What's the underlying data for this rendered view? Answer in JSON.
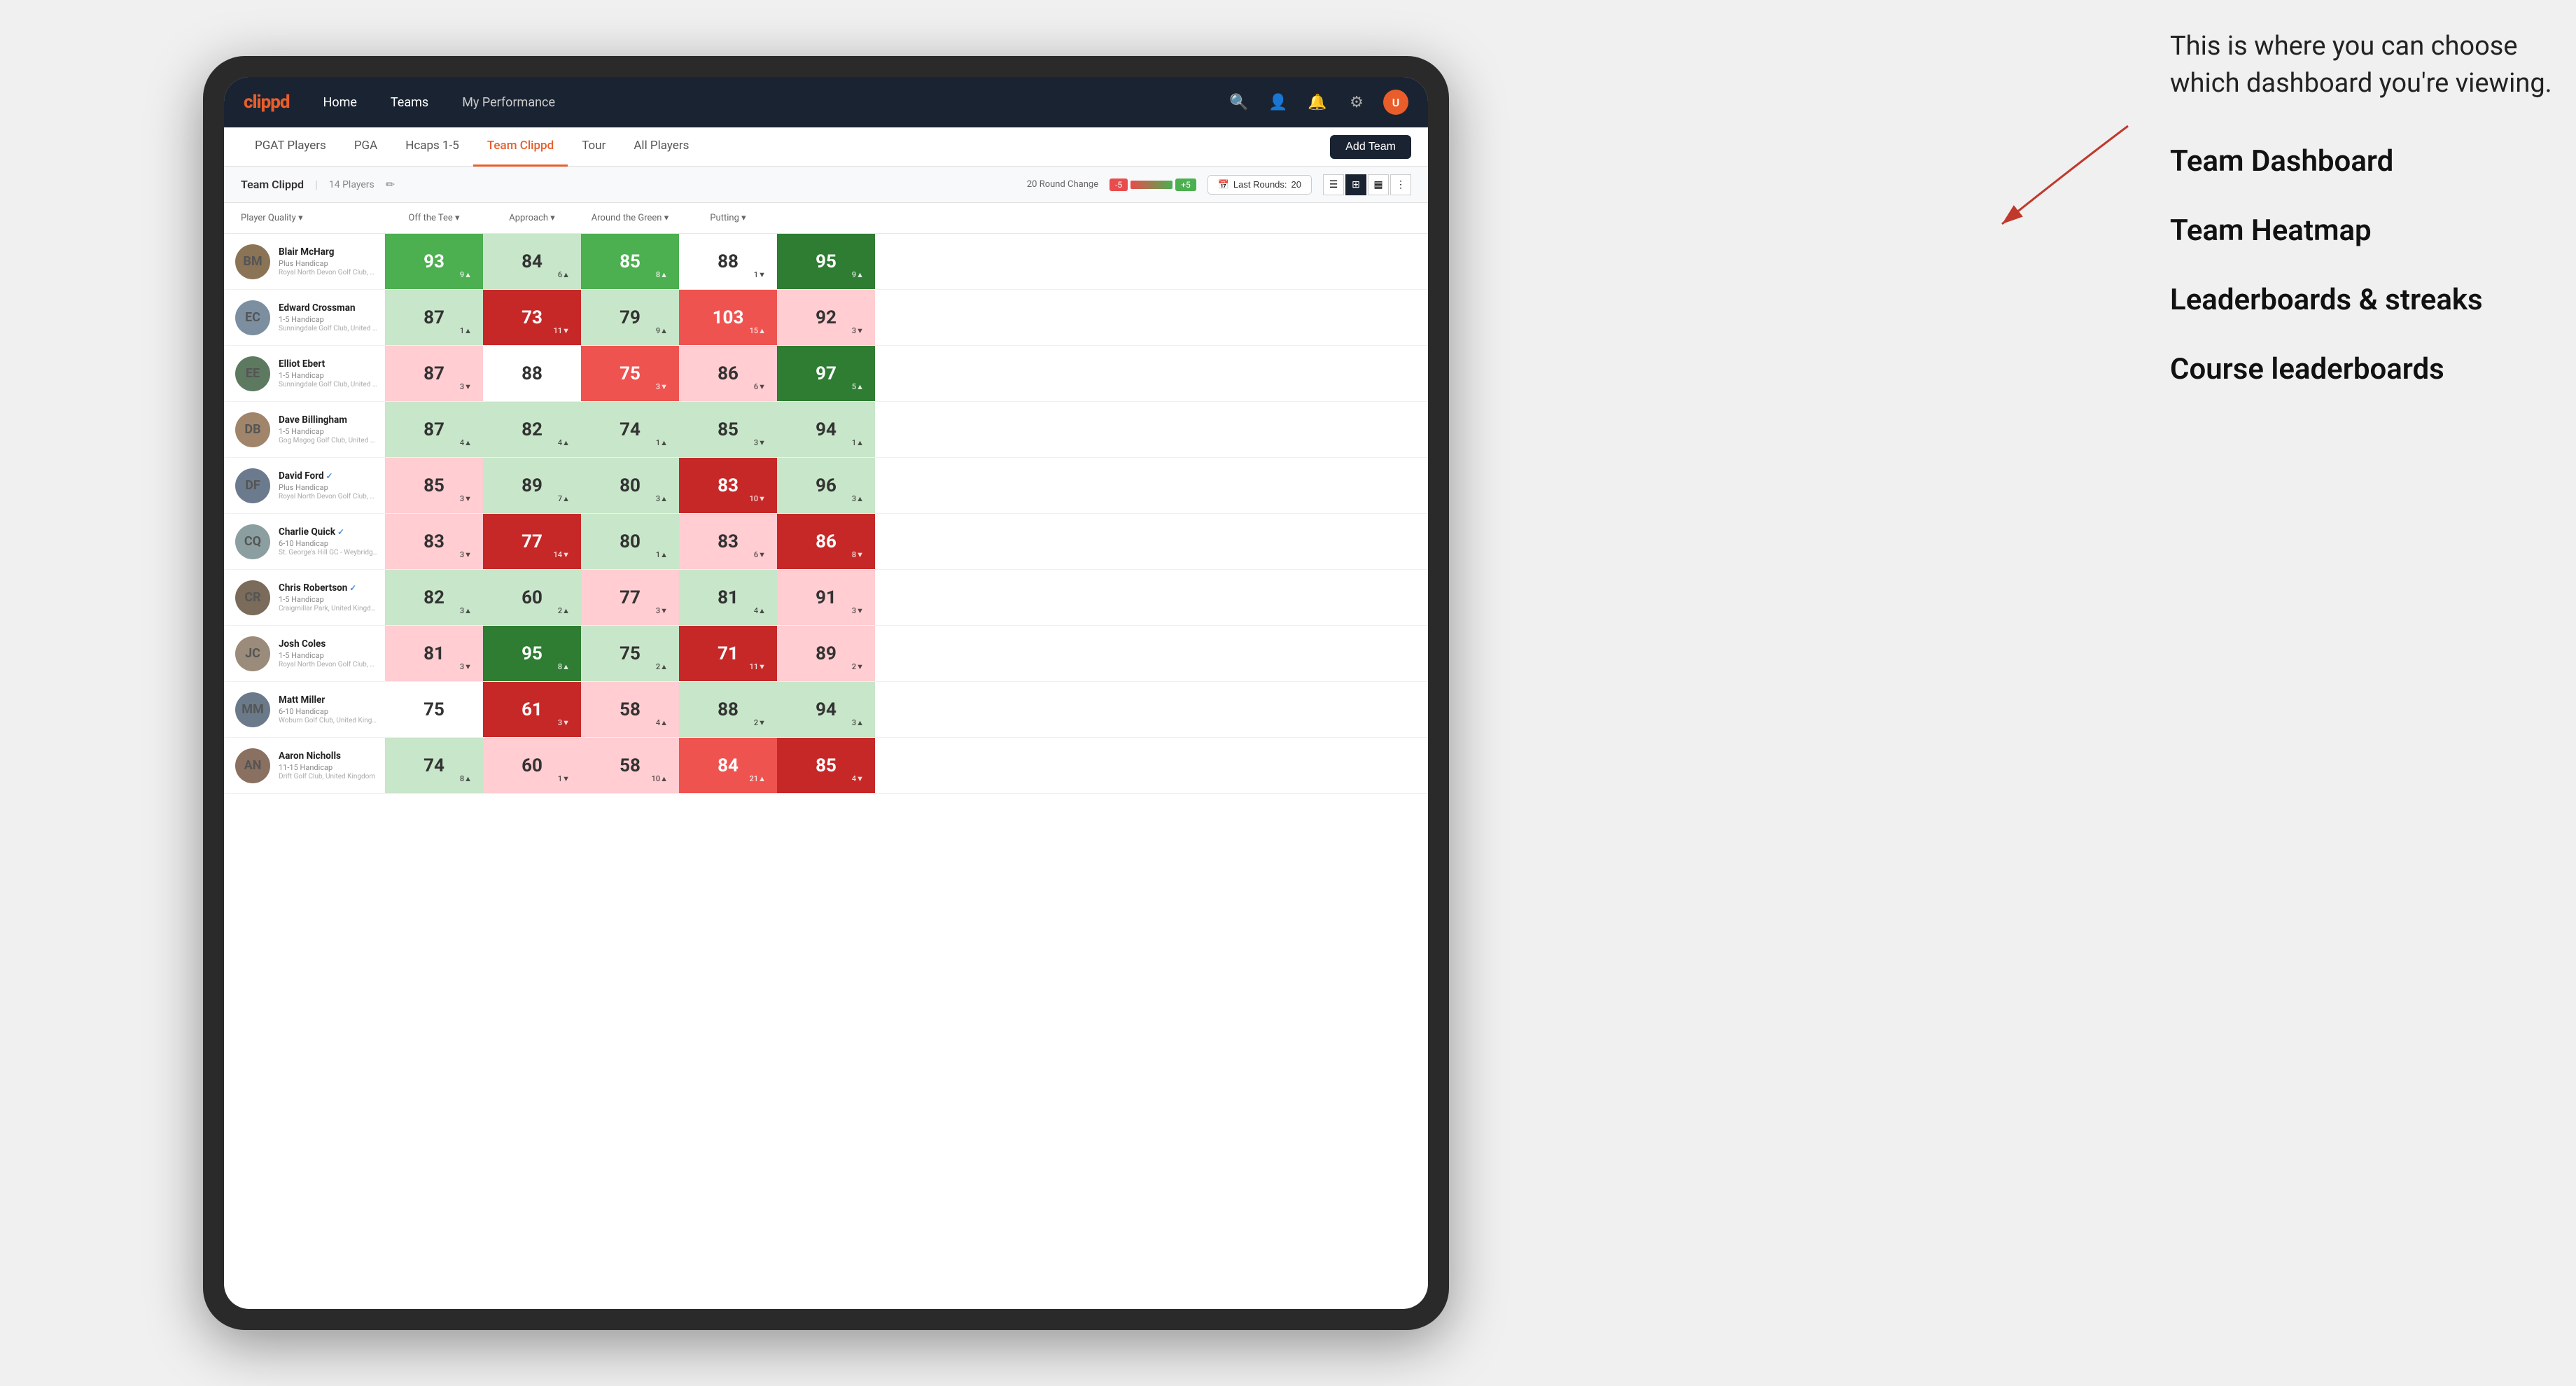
{
  "annotation": {
    "tooltip_text": "This is where you can choose which dashboard you're viewing.",
    "items": [
      "Team Dashboard",
      "Team Heatmap",
      "Leaderboards & streaks",
      "Course leaderboards"
    ]
  },
  "nav": {
    "logo": "clippd",
    "links": [
      "Home",
      "Teams",
      "My Performance"
    ],
    "active_link": "Teams"
  },
  "sub_nav": {
    "items": [
      "PGAT Players",
      "PGA",
      "Hcaps 1-5",
      "Team Clippd",
      "Tour",
      "All Players"
    ],
    "active": "Team Clippd",
    "add_team_label": "Add Team"
  },
  "team_header": {
    "name": "Team Clippd",
    "separator": "|",
    "player_count": "14 Players",
    "round_change_label": "20 Round Change",
    "badge_neg": "-5",
    "badge_pos": "+5",
    "last_rounds_label": "Last Rounds:",
    "last_rounds_value": "20"
  },
  "table": {
    "columns": [
      "Player Quality ▾",
      "Off the Tee ▾",
      "Approach ▾",
      "Around the Green ▾",
      "Putting ▾"
    ],
    "players": [
      {
        "name": "Blair McHarg",
        "handicap": "Plus Handicap",
        "club": "Royal North Devon Golf Club, United Kingdom",
        "avatar_color": "#8B7355",
        "avatar_initials": "BM",
        "scores": [
          {
            "value": 93,
            "change": "9▲",
            "direction": "up",
            "color": "green-med"
          },
          {
            "value": 84,
            "change": "6▲",
            "direction": "up",
            "color": "green-light"
          },
          {
            "value": 85,
            "change": "8▲",
            "direction": "up",
            "color": "green-med"
          },
          {
            "value": 88,
            "change": "1▼",
            "direction": "down",
            "color": "neutral"
          },
          {
            "value": 95,
            "change": "9▲",
            "direction": "up",
            "color": "green-dark"
          }
        ]
      },
      {
        "name": "Edward Crossman",
        "handicap": "1-5 Handicap",
        "club": "Sunningdale Golf Club, United Kingdom",
        "avatar_color": "#7B8FA1",
        "avatar_initials": "EC",
        "scores": [
          {
            "value": 87,
            "change": "1▲",
            "direction": "up",
            "color": "green-light"
          },
          {
            "value": 73,
            "change": "11▼",
            "direction": "down",
            "color": "red-dark"
          },
          {
            "value": 79,
            "change": "9▲",
            "direction": "up",
            "color": "green-light"
          },
          {
            "value": 103,
            "change": "15▲",
            "direction": "up",
            "color": "red-med"
          },
          {
            "value": 92,
            "change": "3▼",
            "direction": "down",
            "color": "red-light"
          }
        ]
      },
      {
        "name": "Elliot Ebert",
        "handicap": "1-5 Handicap",
        "club": "Sunningdale Golf Club, United Kingdom",
        "avatar_color": "#5D7A61",
        "avatar_initials": "EE",
        "scores": [
          {
            "value": 87,
            "change": "3▼",
            "direction": "down",
            "color": "red-light"
          },
          {
            "value": 88,
            "change": "",
            "direction": "none",
            "color": "neutral"
          },
          {
            "value": 75,
            "change": "3▼",
            "direction": "down",
            "color": "red-med"
          },
          {
            "value": 86,
            "change": "6▼",
            "direction": "down",
            "color": "red-light"
          },
          {
            "value": 97,
            "change": "5▲",
            "direction": "up",
            "color": "green-dark"
          }
        ]
      },
      {
        "name": "Dave Billingham",
        "handicap": "1-5 Handicap",
        "club": "Gog Magog Golf Club, United Kingdom",
        "avatar_color": "#A0856B",
        "avatar_initials": "DB",
        "scores": [
          {
            "value": 87,
            "change": "4▲",
            "direction": "up",
            "color": "green-light"
          },
          {
            "value": 82,
            "change": "4▲",
            "direction": "up",
            "color": "green-light"
          },
          {
            "value": 74,
            "change": "1▲",
            "direction": "up",
            "color": "green-light"
          },
          {
            "value": 85,
            "change": "3▼",
            "direction": "down",
            "color": "green-light"
          },
          {
            "value": 94,
            "change": "1▲",
            "direction": "up",
            "color": "green-light"
          }
        ]
      },
      {
        "name": "David Ford",
        "handicap": "Plus Handicap",
        "club": "Royal North Devon Golf Club, United Kingdom",
        "avatar_color": "#6B7B8D",
        "avatar_initials": "DF",
        "verified": true,
        "scores": [
          {
            "value": 85,
            "change": "3▼",
            "direction": "down",
            "color": "red-light"
          },
          {
            "value": 89,
            "change": "7▲",
            "direction": "up",
            "color": "green-light"
          },
          {
            "value": 80,
            "change": "3▲",
            "direction": "up",
            "color": "green-light"
          },
          {
            "value": 83,
            "change": "10▼",
            "direction": "down",
            "color": "red-dark"
          },
          {
            "value": 96,
            "change": "3▲",
            "direction": "up",
            "color": "green-light"
          }
        ]
      },
      {
        "name": "Charlie Quick",
        "handicap": "6-10 Handicap",
        "club": "St. George's Hill GC - Weybridge · Surrey, Uni...",
        "avatar_color": "#8B9EA0",
        "avatar_initials": "CQ",
        "verified": true,
        "scores": [
          {
            "value": 83,
            "change": "3▼",
            "direction": "down",
            "color": "red-light"
          },
          {
            "value": 77,
            "change": "14▼",
            "direction": "down",
            "color": "red-dark"
          },
          {
            "value": 80,
            "change": "1▲",
            "direction": "up",
            "color": "green-light"
          },
          {
            "value": 83,
            "change": "6▼",
            "direction": "down",
            "color": "red-light"
          },
          {
            "value": 86,
            "change": "8▼",
            "direction": "down",
            "color": "red-dark"
          }
        ]
      },
      {
        "name": "Chris Robertson",
        "handicap": "1-5 Handicap",
        "club": "Craigmillar Park, United Kingdom",
        "avatar_color": "#7A6B5A",
        "avatar_initials": "CR",
        "verified": true,
        "scores": [
          {
            "value": 82,
            "change": "3▲",
            "direction": "up",
            "color": "green-light"
          },
          {
            "value": 60,
            "change": "2▲",
            "direction": "up",
            "color": "green-light"
          },
          {
            "value": 77,
            "change": "3▼",
            "direction": "down",
            "color": "red-light"
          },
          {
            "value": 81,
            "change": "4▲",
            "direction": "up",
            "color": "green-light"
          },
          {
            "value": 91,
            "change": "3▼",
            "direction": "down",
            "color": "red-light"
          }
        ]
      },
      {
        "name": "Josh Coles",
        "handicap": "1-5 Handicap",
        "club": "Royal North Devon Golf Club, United Kingdom",
        "avatar_color": "#9B8B7A",
        "avatar_initials": "JC",
        "scores": [
          {
            "value": 81,
            "change": "3▼",
            "direction": "down",
            "color": "red-light"
          },
          {
            "value": 95,
            "change": "8▲",
            "direction": "up",
            "color": "green-dark"
          },
          {
            "value": 75,
            "change": "2▲",
            "direction": "up",
            "color": "green-light"
          },
          {
            "value": 71,
            "change": "11▼",
            "direction": "down",
            "color": "red-dark"
          },
          {
            "value": 89,
            "change": "2▼",
            "direction": "down",
            "color": "red-light"
          }
        ]
      },
      {
        "name": "Matt Miller",
        "handicap": "6-10 Handicap",
        "club": "Woburn Golf Club, United Kingdom",
        "avatar_color": "#6A7A8A",
        "avatar_initials": "MM",
        "scores": [
          {
            "value": 75,
            "change": "",
            "direction": "none",
            "color": "neutral"
          },
          {
            "value": 61,
            "change": "3▼",
            "direction": "down",
            "color": "red-dark"
          },
          {
            "value": 58,
            "change": "4▲",
            "direction": "up",
            "color": "red-light"
          },
          {
            "value": 88,
            "change": "2▼",
            "direction": "down",
            "color": "green-light"
          },
          {
            "value": 94,
            "change": "3▲",
            "direction": "up",
            "color": "green-light"
          }
        ]
      },
      {
        "name": "Aaron Nicholls",
        "handicap": "11-15 Handicap",
        "club": "Drift Golf Club, United Kingdom",
        "avatar_color": "#8A7060",
        "avatar_initials": "AN",
        "scores": [
          {
            "value": 74,
            "change": "8▲",
            "direction": "up",
            "color": "green-light"
          },
          {
            "value": 60,
            "change": "1▼",
            "direction": "down",
            "color": "red-light"
          },
          {
            "value": 58,
            "change": "10▲",
            "direction": "up",
            "color": "red-light"
          },
          {
            "value": 84,
            "change": "21▲",
            "direction": "up",
            "color": "red-med"
          },
          {
            "value": 85,
            "change": "4▼",
            "direction": "down",
            "color": "red-dark"
          }
        ]
      }
    ]
  }
}
